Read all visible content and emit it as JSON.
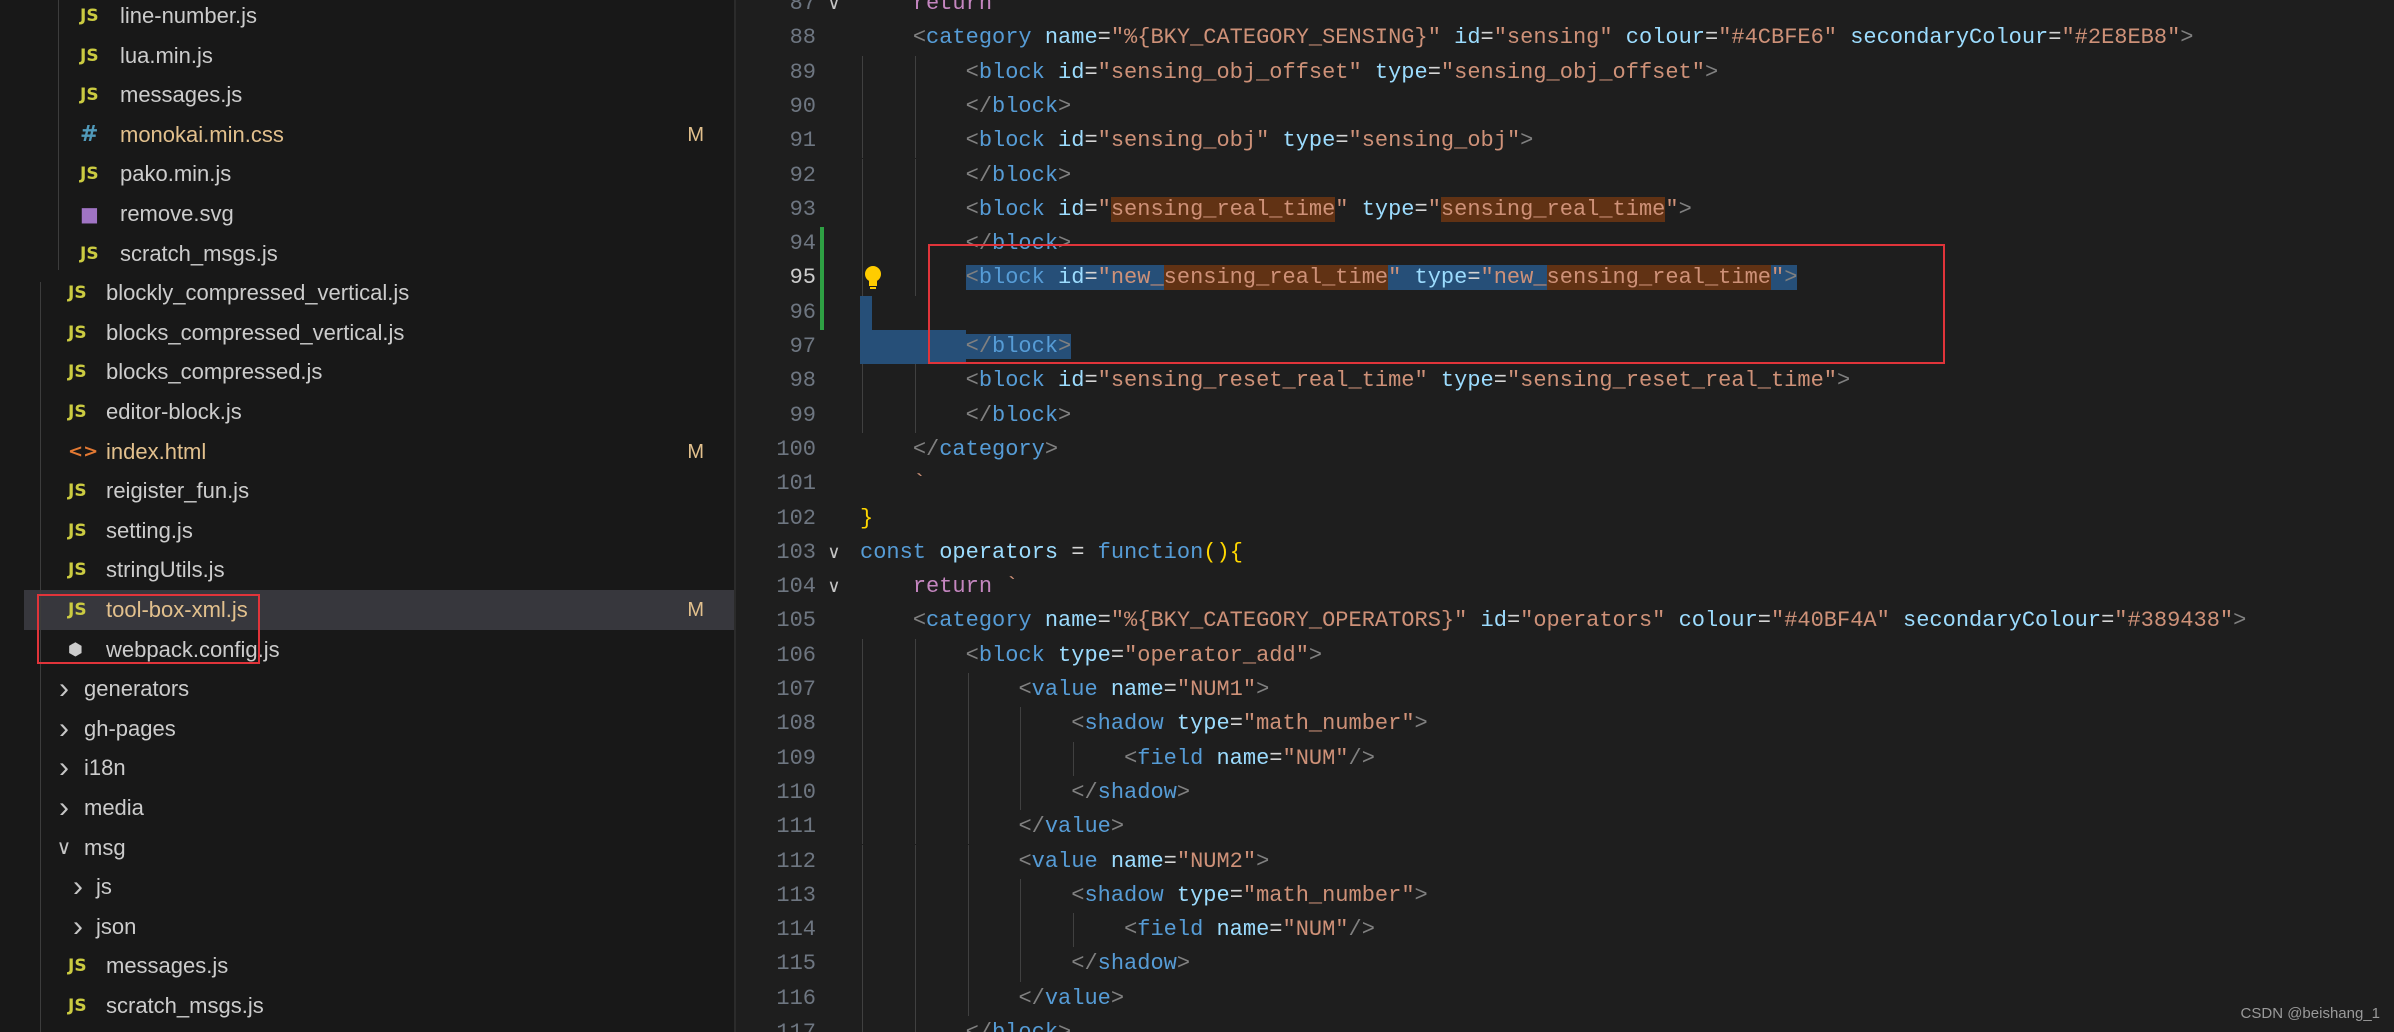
{
  "explorer": {
    "items": [
      {
        "kind": "file",
        "icon": "js",
        "label": "line-number.js"
      },
      {
        "kind": "file",
        "icon": "js",
        "label": "lua.min.js"
      },
      {
        "kind": "file",
        "icon": "js",
        "label": "messages.js"
      },
      {
        "kind": "file",
        "icon": "css",
        "label": "monokai.min.css",
        "badge": "M"
      },
      {
        "kind": "file",
        "icon": "js",
        "label": "pako.min.js"
      },
      {
        "kind": "file",
        "icon": "svg",
        "label": "remove.svg"
      },
      {
        "kind": "file",
        "icon": "js",
        "label": "scratch_msgs.js"
      },
      {
        "kind": "file",
        "icon": "js",
        "label": "blockly_compressed_vertical.js"
      },
      {
        "kind": "file",
        "icon": "js",
        "label": "blocks_compressed_vertical.js"
      },
      {
        "kind": "file",
        "icon": "js",
        "label": "blocks_compressed.js"
      },
      {
        "kind": "file",
        "icon": "js",
        "label": "editor-block.js"
      },
      {
        "kind": "file",
        "icon": "html",
        "label": "index.html",
        "badge": "M"
      },
      {
        "kind": "file",
        "icon": "js",
        "label": "reigister_fun.js"
      },
      {
        "kind": "file",
        "icon": "js",
        "label": "setting.js"
      },
      {
        "kind": "file",
        "icon": "js",
        "label": "stringUtils.js"
      },
      {
        "kind": "file",
        "icon": "js",
        "label": "tool-box-xml.js",
        "badge": "M",
        "selected": true
      },
      {
        "kind": "file",
        "icon": "webpack",
        "label": "webpack.config.js"
      },
      {
        "kind": "folder",
        "label": "generators",
        "expanded": false
      },
      {
        "kind": "folder",
        "label": "gh-pages",
        "expanded": false
      },
      {
        "kind": "folder",
        "label": "i18n",
        "expanded": false
      },
      {
        "kind": "folder",
        "label": "media",
        "expanded": false
      },
      {
        "kind": "folder",
        "label": "msg",
        "expanded": true
      },
      {
        "kind": "folder",
        "label": "js",
        "expanded": false
      },
      {
        "kind": "folder",
        "label": "json",
        "expanded": false
      },
      {
        "kind": "file",
        "icon": "js",
        "label": "messages.js"
      },
      {
        "kind": "file",
        "icon": "js",
        "label": "scratch_msgs.js"
      }
    ]
  },
  "editor": {
    "lines": [
      {
        "n": "87",
        "fold": "v",
        "indent": 1,
        "tokens": [
          [
            "t-kw",
            "return"
          ]
        ]
      },
      {
        "n": "88",
        "indent": 1,
        "tokens": [
          [
            "t-tag",
            "<"
          ],
          [
            "t-name",
            "category"
          ],
          [
            "t-plain",
            " "
          ],
          [
            "t-attr",
            "name"
          ],
          [
            "t-plain",
            "="
          ],
          [
            "t-str",
            "\"%{BKY_CATEGORY_SENSING}\""
          ],
          [
            "t-plain",
            " "
          ],
          [
            "t-attr",
            "id"
          ],
          [
            "t-plain",
            "="
          ],
          [
            "t-str",
            "\"sensing\""
          ],
          [
            "t-plain",
            " "
          ],
          [
            "t-attr",
            "colour"
          ],
          [
            "t-plain",
            "="
          ],
          [
            "t-str",
            "\"#4CBFE6\""
          ],
          [
            "t-plain",
            " "
          ],
          [
            "t-attr",
            "secondaryColour"
          ],
          [
            "t-plain",
            "="
          ],
          [
            "t-str",
            "\"#2E8EB8\""
          ],
          [
            "t-tag",
            ">"
          ]
        ]
      },
      {
        "n": "89",
        "indent": 2,
        "tokens": [
          [
            "t-tag",
            "<"
          ],
          [
            "t-name",
            "block"
          ],
          [
            "t-plain",
            " "
          ],
          [
            "t-attr",
            "id"
          ],
          [
            "t-plain",
            "="
          ],
          [
            "t-str",
            "\"sensing_obj_offset\""
          ],
          [
            "t-plain",
            " "
          ],
          [
            "t-attr",
            "type"
          ],
          [
            "t-plain",
            "="
          ],
          [
            "t-str",
            "\"sensing_obj_offset\""
          ],
          [
            "t-tag",
            ">"
          ]
        ]
      },
      {
        "n": "90",
        "indent": 2,
        "tokens": [
          [
            "t-tag",
            "</"
          ],
          [
            "t-name",
            "block"
          ],
          [
            "t-tag",
            ">"
          ]
        ]
      },
      {
        "n": "91",
        "indent": 2,
        "tokens": [
          [
            "t-tag",
            "<"
          ],
          [
            "t-name",
            "block"
          ],
          [
            "t-plain",
            " "
          ],
          [
            "t-attr",
            "id"
          ],
          [
            "t-plain",
            "="
          ],
          [
            "t-str",
            "\"sensing_obj\""
          ],
          [
            "t-plain",
            " "
          ],
          [
            "t-attr",
            "type"
          ],
          [
            "t-plain",
            "="
          ],
          [
            "t-str",
            "\"sensing_obj\""
          ],
          [
            "t-tag",
            ">"
          ]
        ]
      },
      {
        "n": "92",
        "indent": 2,
        "tokens": [
          [
            "t-tag",
            "</"
          ],
          [
            "t-name",
            "block"
          ],
          [
            "t-tag",
            ">"
          ]
        ]
      },
      {
        "n": "93",
        "indent": 2,
        "tokens": [
          [
            "t-tag",
            "<"
          ],
          [
            "t-name",
            "block"
          ],
          [
            "t-plain",
            " "
          ],
          [
            "t-attr",
            "id"
          ],
          [
            "t-plain",
            "="
          ],
          [
            "t-str",
            "\""
          ],
          [
            "t-str occ",
            "sensing_real_time"
          ],
          [
            "t-str",
            "\""
          ],
          [
            "t-plain",
            " "
          ],
          [
            "t-attr",
            "type"
          ],
          [
            "t-plain",
            "="
          ],
          [
            "t-str",
            "\""
          ],
          [
            "t-str occ",
            "sensing_real_time"
          ],
          [
            "t-str",
            "\""
          ],
          [
            "t-tag",
            ">"
          ]
        ]
      },
      {
        "n": "94",
        "indent": 2,
        "tokens": [
          [
            "t-tag",
            "</"
          ],
          [
            "t-name",
            "block"
          ],
          [
            "t-tag",
            ">"
          ]
        ]
      },
      {
        "n": "95",
        "indent": 2,
        "active": true,
        "sel": true,
        "tokens": [
          [
            "t-tag",
            "<"
          ],
          [
            "t-name",
            "block"
          ],
          [
            "t-plain",
            " "
          ],
          [
            "t-attr",
            "id"
          ],
          [
            "t-plain",
            "="
          ],
          [
            "t-str",
            "\"new_"
          ],
          [
            "t-str occ",
            "sensing_real_time"
          ],
          [
            "t-str",
            "\""
          ],
          [
            "t-plain",
            " "
          ],
          [
            "t-attr",
            "type"
          ],
          [
            "t-plain",
            "="
          ],
          [
            "t-str",
            "\"new_"
          ],
          [
            "t-str occ",
            "sensing_real_time"
          ],
          [
            "t-str",
            "\""
          ],
          [
            "t-tag",
            ">"
          ]
        ]
      },
      {
        "n": "96",
        "indent": 0,
        "tokens": []
      },
      {
        "n": "97",
        "indent": 2,
        "sel": true,
        "tokens": [
          [
            "t-tag",
            "</"
          ],
          [
            "t-name",
            "block"
          ],
          [
            "t-tag",
            ">"
          ]
        ]
      },
      {
        "n": "98",
        "indent": 2,
        "tokens": [
          [
            "t-tag",
            "<"
          ],
          [
            "t-name",
            "block"
          ],
          [
            "t-plain",
            " "
          ],
          [
            "t-attr",
            "id"
          ],
          [
            "t-plain",
            "="
          ],
          [
            "t-str",
            "\"sensing_reset_real_time\""
          ],
          [
            "t-plain",
            " "
          ],
          [
            "t-attr",
            "type"
          ],
          [
            "t-plain",
            "="
          ],
          [
            "t-str",
            "\"sensing_reset_real_time\""
          ],
          [
            "t-tag",
            ">"
          ]
        ]
      },
      {
        "n": "99",
        "indent": 2,
        "tokens": [
          [
            "t-tag",
            "</"
          ],
          [
            "t-name",
            "block"
          ],
          [
            "t-tag",
            ">"
          ]
        ]
      },
      {
        "n": "100",
        "indent": 1,
        "tokens": [
          [
            "t-tag",
            "</"
          ],
          [
            "t-name",
            "category"
          ],
          [
            "t-tag",
            ">"
          ]
        ]
      },
      {
        "n": "101",
        "indent": 1,
        "tokens": [
          [
            "t-str",
            "`"
          ]
        ]
      },
      {
        "n": "102",
        "indent": 0,
        "tokens": [
          [
            "t-brace",
            "}"
          ]
        ]
      },
      {
        "n": "103",
        "fold": "v",
        "indent": 0,
        "tokens": [
          [
            "t-fn",
            "const"
          ],
          [
            "t-plain",
            " "
          ],
          [
            "t-var",
            "operators"
          ],
          [
            "t-plain",
            " = "
          ],
          [
            "t-fn",
            "function"
          ],
          [
            "t-brace",
            "()"
          ],
          [
            "t-brace",
            "{"
          ]
        ]
      },
      {
        "n": "104",
        "fold": "v",
        "indent": 1,
        "tokens": [
          [
            "t-kw",
            "return"
          ],
          [
            "t-plain",
            " "
          ],
          [
            "t-str",
            "`"
          ]
        ]
      },
      {
        "n": "105",
        "indent": 1,
        "tokens": [
          [
            "t-tag",
            "<"
          ],
          [
            "t-name",
            "category"
          ],
          [
            "t-plain",
            " "
          ],
          [
            "t-attr",
            "name"
          ],
          [
            "t-plain",
            "="
          ],
          [
            "t-str",
            "\"%{BKY_CATEGORY_OPERATORS}\""
          ],
          [
            "t-plain",
            " "
          ],
          [
            "t-attr",
            "id"
          ],
          [
            "t-plain",
            "="
          ],
          [
            "t-str",
            "\"operators\""
          ],
          [
            "t-plain",
            " "
          ],
          [
            "t-attr",
            "colour"
          ],
          [
            "t-plain",
            "="
          ],
          [
            "t-str",
            "\"#40BF4A\""
          ],
          [
            "t-plain",
            " "
          ],
          [
            "t-attr",
            "secondaryColour"
          ],
          [
            "t-plain",
            "="
          ],
          [
            "t-str",
            "\"#389438\""
          ],
          [
            "t-tag",
            ">"
          ]
        ]
      },
      {
        "n": "106",
        "indent": 2,
        "tokens": [
          [
            "t-tag",
            "<"
          ],
          [
            "t-name",
            "block"
          ],
          [
            "t-plain",
            " "
          ],
          [
            "t-attr",
            "type"
          ],
          [
            "t-plain",
            "="
          ],
          [
            "t-str",
            "\"operator_add\""
          ],
          [
            "t-tag",
            ">"
          ]
        ]
      },
      {
        "n": "107",
        "indent": 3,
        "tokens": [
          [
            "t-tag",
            "<"
          ],
          [
            "t-name",
            "value"
          ],
          [
            "t-plain",
            " "
          ],
          [
            "t-attr",
            "name"
          ],
          [
            "t-plain",
            "="
          ],
          [
            "t-str",
            "\"NUM1\""
          ],
          [
            "t-tag",
            ">"
          ]
        ]
      },
      {
        "n": "108",
        "indent": 4,
        "tokens": [
          [
            "t-tag",
            "<"
          ],
          [
            "t-name",
            "shadow"
          ],
          [
            "t-plain",
            " "
          ],
          [
            "t-attr",
            "type"
          ],
          [
            "t-plain",
            "="
          ],
          [
            "t-str",
            "\"math_number\""
          ],
          [
            "t-tag",
            ">"
          ]
        ]
      },
      {
        "n": "109",
        "indent": 5,
        "tokens": [
          [
            "t-tag",
            "<"
          ],
          [
            "t-name",
            "field"
          ],
          [
            "t-plain",
            " "
          ],
          [
            "t-attr",
            "name"
          ],
          [
            "t-plain",
            "="
          ],
          [
            "t-str",
            "\"NUM\""
          ],
          [
            "t-tag",
            "/>"
          ]
        ]
      },
      {
        "n": "110",
        "indent": 4,
        "tokens": [
          [
            "t-tag",
            "</"
          ],
          [
            "t-name",
            "shadow"
          ],
          [
            "t-tag",
            ">"
          ]
        ]
      },
      {
        "n": "111",
        "indent": 3,
        "tokens": [
          [
            "t-tag",
            "</"
          ],
          [
            "t-name",
            "value"
          ],
          [
            "t-tag",
            ">"
          ]
        ]
      },
      {
        "n": "112",
        "indent": 3,
        "tokens": [
          [
            "t-tag",
            "<"
          ],
          [
            "t-name",
            "value"
          ],
          [
            "t-plain",
            " "
          ],
          [
            "t-attr",
            "name"
          ],
          [
            "t-plain",
            "="
          ],
          [
            "t-str",
            "\"NUM2\""
          ],
          [
            "t-tag",
            ">"
          ]
        ]
      },
      {
        "n": "113",
        "indent": 4,
        "tokens": [
          [
            "t-tag",
            "<"
          ],
          [
            "t-name",
            "shadow"
          ],
          [
            "t-plain",
            " "
          ],
          [
            "t-attr",
            "type"
          ],
          [
            "t-plain",
            "="
          ],
          [
            "t-str",
            "\"math_number\""
          ],
          [
            "t-tag",
            ">"
          ]
        ]
      },
      {
        "n": "114",
        "indent": 5,
        "tokens": [
          [
            "t-tag",
            "<"
          ],
          [
            "t-name",
            "field"
          ],
          [
            "t-plain",
            " "
          ],
          [
            "t-attr",
            "name"
          ],
          [
            "t-plain",
            "="
          ],
          [
            "t-str",
            "\"NUM\""
          ],
          [
            "t-tag",
            "/>"
          ]
        ]
      },
      {
        "n": "115",
        "indent": 4,
        "tokens": [
          [
            "t-tag",
            "</"
          ],
          [
            "t-name",
            "shadow"
          ],
          [
            "t-tag",
            ">"
          ]
        ]
      },
      {
        "n": "116",
        "indent": 3,
        "tokens": [
          [
            "t-tag",
            "</"
          ],
          [
            "t-name",
            "value"
          ],
          [
            "t-tag",
            ">"
          ]
        ]
      },
      {
        "n": "117",
        "indent": 2,
        "tokens": [
          [
            "t-tag",
            "</"
          ],
          [
            "t-name",
            "block"
          ],
          [
            "t-tag",
            ">"
          ]
        ]
      }
    ]
  },
  "watermark": "CSDN @beishang_1",
  "colors": {
    "selection": "#264f78",
    "occurrence": "#613214",
    "annotation_box": "#e0343a",
    "modified_badge": "#e2c08d",
    "git_added": "#2ea043"
  }
}
